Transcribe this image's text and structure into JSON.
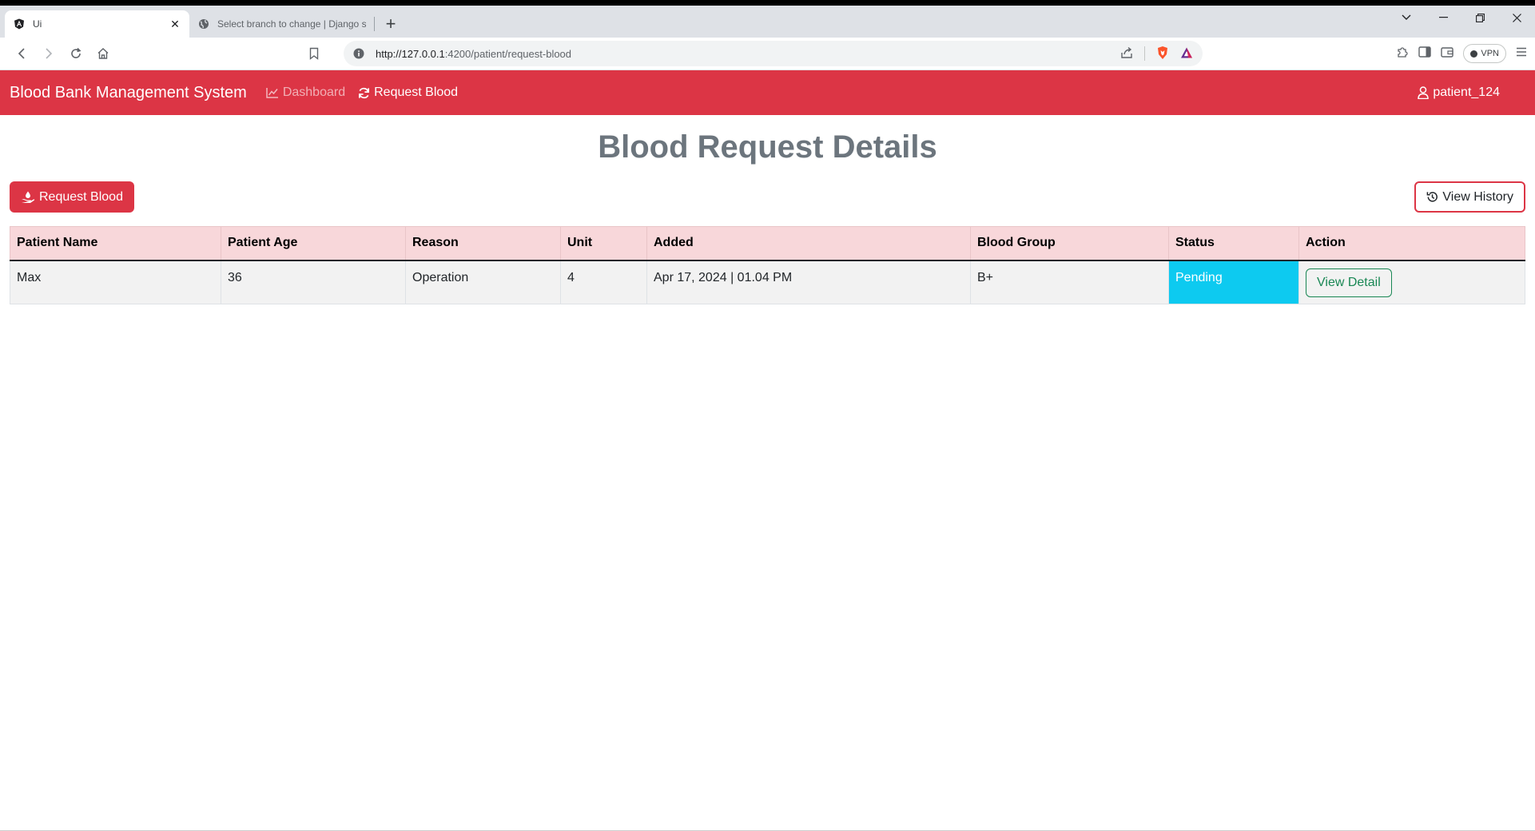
{
  "browser": {
    "tabs": [
      {
        "title": "Ui",
        "active": true
      },
      {
        "title": "Select branch to change | Django site",
        "active": false
      }
    ],
    "url_host": "http://127.0.0.1",
    "url_path": ":4200/patient/request-blood",
    "vpn_label": "VPN"
  },
  "navbar": {
    "brand": "Blood Bank Management System",
    "links": [
      {
        "label": "Dashboard",
        "icon": "chart-line-icon"
      },
      {
        "label": "Request Blood",
        "icon": "refresh-icon"
      }
    ],
    "user": "patient_124",
    "color": "#dc3545"
  },
  "page": {
    "title": "Blood Request Details",
    "request_button": "Request Blood",
    "history_button": "View History"
  },
  "table": {
    "headers": [
      "Patient Name",
      "Patient Age",
      "Reason",
      "Unit",
      "Added",
      "Blood Group",
      "Status",
      "Action"
    ],
    "rows": [
      {
        "patient_name": "Max",
        "patient_age": "36",
        "reason": "Operation",
        "unit": "4",
        "added": "Apr 17, 2024 | 01.04 PM",
        "blood_group": "B+",
        "status": "Pending",
        "action": "View Detail"
      }
    ],
    "status_color": "#0dcaf0"
  }
}
